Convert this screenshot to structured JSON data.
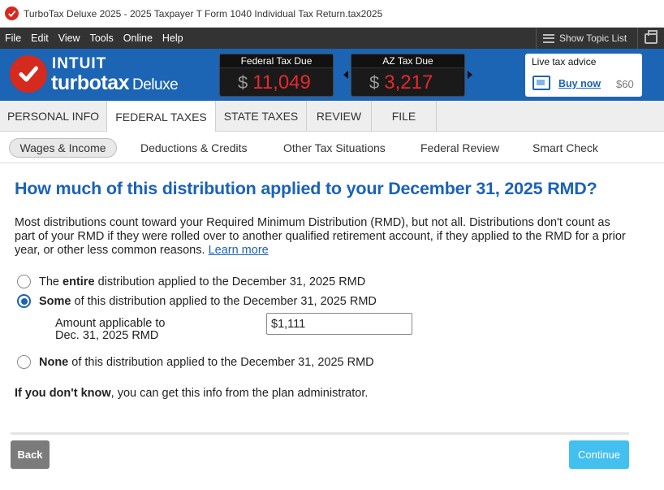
{
  "window": {
    "title": "TurboTax Deluxe 2025 - 2025 Taxpayer T Form 1040  Individual Tax Return.tax2025"
  },
  "menu": {
    "items": [
      "File",
      "Edit",
      "View",
      "Tools",
      "Online",
      "Help"
    ],
    "show_topic_list": "Show Topic List"
  },
  "brand": {
    "intuit": "INTUIT",
    "turbotax": "turbotax",
    "edition": "Deluxe"
  },
  "tax_due": {
    "federal": {
      "label": "Federal Tax Due",
      "dollar": "$",
      "amount": "11,049"
    },
    "state": {
      "label": "AZ Tax Due",
      "dollar": "$",
      "amount": "3,217"
    }
  },
  "advice": {
    "title": "Live tax advice",
    "buy_label": "Buy now",
    "price": "$60"
  },
  "tabs": [
    "PERSONAL INFO",
    "FEDERAL TAXES",
    "STATE TAXES",
    "REVIEW",
    "FILE"
  ],
  "subtabs": [
    "Wages & Income",
    "Deductions & Credits",
    "Other Tax Situations",
    "Federal Review",
    "Smart Check"
  ],
  "page": {
    "question": "How much of this distribution applied to your December 31, 2025 RMD?",
    "explanation": "Most distributions count toward your Required Minimum Distribution (RMD), but not all. Distributions don't count as part of your RMD if they were rolled over to another qualified retirement account, if they applied to the RMD for a prior year, or other less common reasons.",
    "learn_more": "Learn more",
    "options": {
      "entire": {
        "bold": "entire",
        "prefix": "The",
        "suffix": "distribution applied to the December 31, 2025 RMD",
        "selected": false
      },
      "some": {
        "bold": "Some",
        "suffix": "of this distribution applied to the December 31, 2025 RMD",
        "selected": true
      },
      "none": {
        "bold": "None",
        "suffix": "of this distribution applied to the December 31, 2025 RMD",
        "selected": false
      }
    },
    "amount_label_line1": "Amount applicable to",
    "amount_label_line2": "Dec. 31, 2025 RMD",
    "amount_value": "$1,111",
    "dont_know_bold": "If you don't know",
    "dont_know_rest": ", you can get this info from the plan administrator."
  },
  "buttons": {
    "back": "Back",
    "continue": "Continue"
  },
  "colors": {
    "brand_blue": "#1c64b4",
    "link_blue": "#1a62b8",
    "tax_red": "#e8282d",
    "continue": "#43bff0",
    "back": "#7b7b7b"
  }
}
